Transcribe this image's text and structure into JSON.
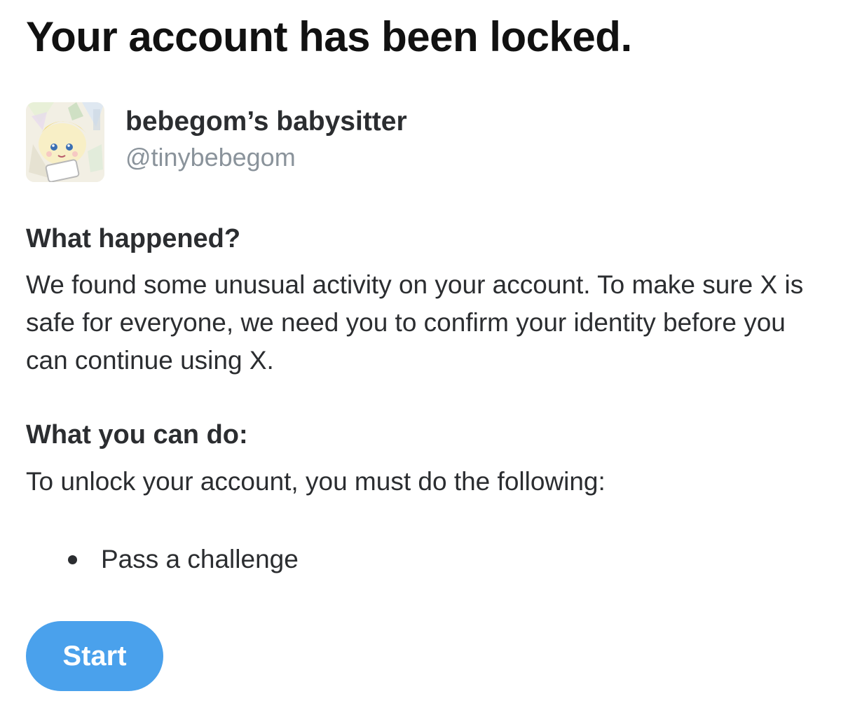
{
  "title": "Your account has been locked.",
  "account": {
    "display_name": "bebegom’s babysitter",
    "handle": "@tinybebegom",
    "avatar_icon": "avatar-image"
  },
  "what_happened": {
    "heading": "What happened?",
    "text": "We found some unusual activity on your account. To make sure X is safe for everyone, we need you to confirm your identity before you can continue using X."
  },
  "what_you_can_do": {
    "heading": "What you can do:",
    "text": "To unlock your account, you must do the following:",
    "steps": [
      {
        "label": "Pass a challenge"
      }
    ]
  },
  "start_button": {
    "label": "Start"
  },
  "colors": {
    "accent": "#4aa1ec",
    "text": "#2b2d30",
    "muted": "#8a939b"
  }
}
